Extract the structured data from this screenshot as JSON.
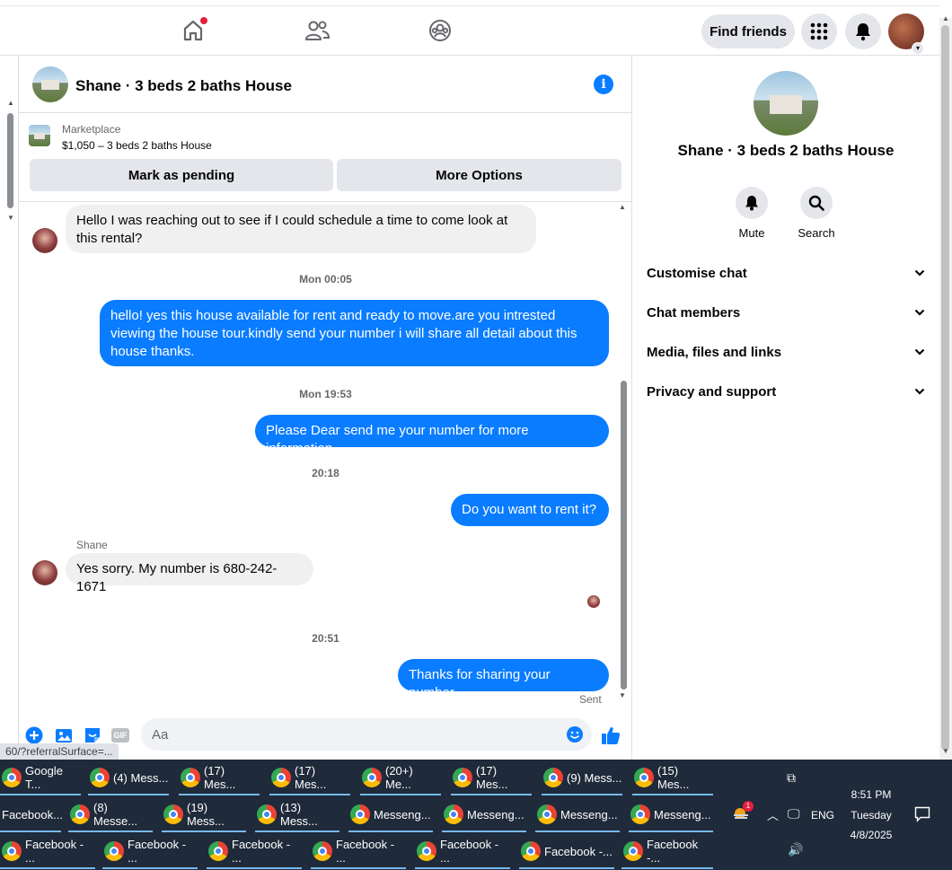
{
  "topbar": {
    "find_friends": "Find friends"
  },
  "chat": {
    "title": "Shane · 3 beds 2 baths House",
    "marketplace_label": "Marketplace",
    "listing": "$1,050 – 3 beds 2 baths House",
    "mark_pending": "Mark as pending",
    "more_options": "More Options",
    "messages": {
      "m1": "Hello I was reaching out to see if I could schedule a time to come look at this rental?",
      "ts1": "Mon 00:05",
      "m2": "hello! yes this house available for rent and ready to move.are you intrested viewing the house tour.kindly send your number i will share all detail about this house thanks.",
      "ts2": "Mon 19:53",
      "m3": "Please Dear send me your number for more information",
      "ts3": "20:18",
      "m4": "Do you want to rent it?",
      "sender": "Shane",
      "m5": "Yes sorry. My number is 680-242-1671",
      "ts4": "20:51",
      "m6": "Thanks for sharing your number",
      "sent": "Sent"
    },
    "composer_placeholder": "Aa"
  },
  "status_url": "60/?referralSurface=...",
  "right": {
    "title": "Shane · 3 beds 2 baths House",
    "mute": "Mute",
    "search": "Search",
    "sections": [
      "Customise chat",
      "Chat members",
      "Media, files and links",
      "Privacy and support"
    ]
  },
  "taskbar": {
    "row1": [
      "Google T...",
      "(4) Mess...",
      "(17) Mes...",
      "(17) Mes...",
      "(20+) Me...",
      "(17) Mes...",
      "(9) Mess...",
      "(15) Mes..."
    ],
    "row2": [
      "Facebook...",
      "(8) Messe...",
      "(19) Mess...",
      "(13) Mess...",
      "Messeng...",
      "Messeng...",
      "Messeng...",
      "Messeng..."
    ],
    "row3": [
      "Facebook - ...",
      "Facebook - ...",
      "Facebook - ...",
      "Facebook - ...",
      "Facebook - ...",
      "Facebook -...",
      "Facebook -..."
    ],
    "time": "8:51 PM",
    "day": "Tuesday",
    "date": "4/8/2025",
    "lang": "ENG",
    "weather_badge": "1"
  },
  "colors": {
    "accent": "#0a7cff",
    "bubble_in": "#f0f0f0",
    "taskbar": "#1f2a3a"
  }
}
